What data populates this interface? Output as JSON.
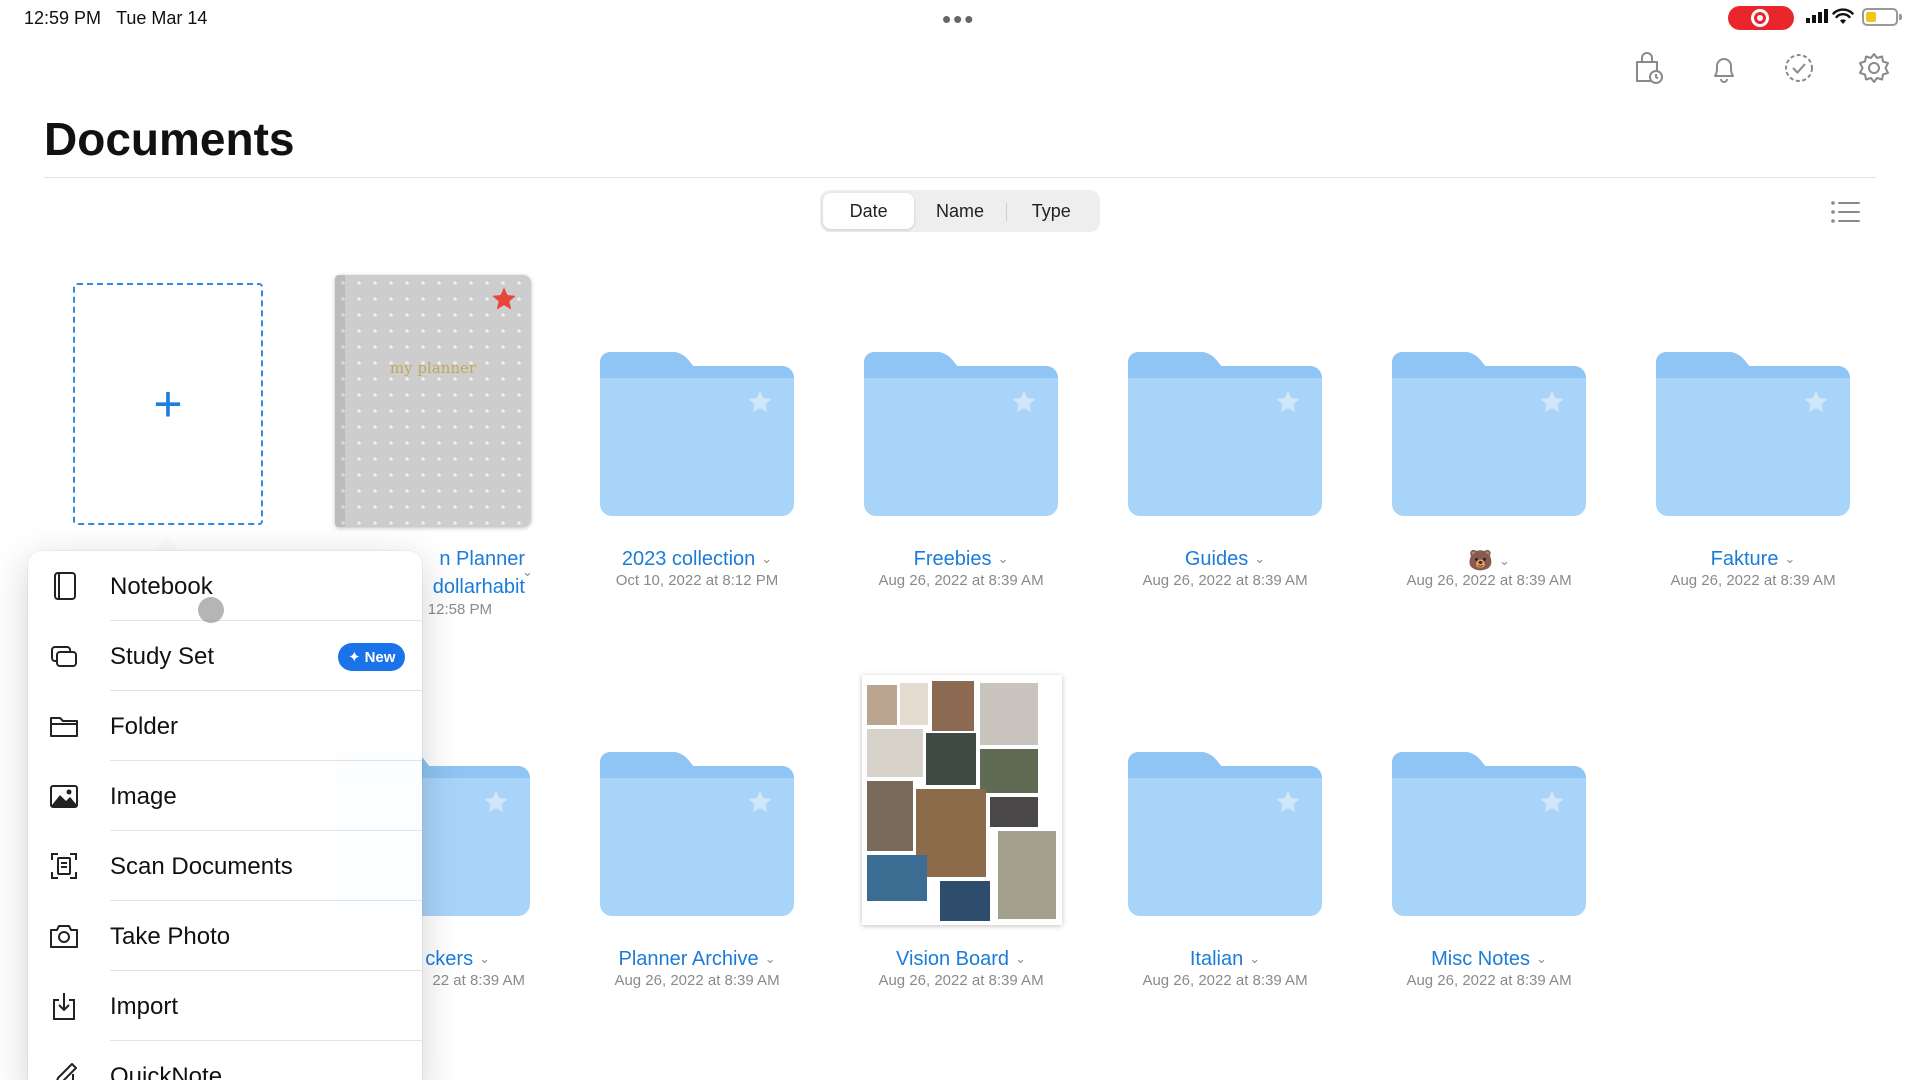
{
  "status": {
    "time": "12:59 PM",
    "date": "Tue Mar 14",
    "dots": "•••"
  },
  "page": {
    "title": "Documents"
  },
  "sort": {
    "options": [
      "Date",
      "Name",
      "Type"
    ],
    "active": "Date"
  },
  "notebook": {
    "cover_title": "my planner",
    "name_line1": "n Planner",
    "name_line2": "dollarhabit",
    "date": "12:58 PM"
  },
  "folders_row1": [
    {
      "name": "2023 collection",
      "date": "Oct 10, 2022 at 8:12 PM"
    },
    {
      "name": "Freebies",
      "date": "Aug 26, 2022 at 8:39 AM"
    },
    {
      "name": "Guides",
      "date": "Aug 26, 2022 at 8:39 AM"
    },
    {
      "name": "🐻",
      "date": "Aug 26, 2022 at 8:39 AM"
    },
    {
      "name": "Fakture",
      "date": "Aug 26, 2022 at 8:39 AM"
    }
  ],
  "folders_row2": [
    {
      "name": "ckers",
      "date": "22 at 8:39 AM"
    },
    {
      "name": "Planner Archive",
      "date": "Aug 26, 2022 at 8:39 AM"
    },
    {
      "name": "Vision Board",
      "date": "Aug 26, 2022 at 8:39 AM"
    },
    {
      "name": "Italian",
      "date": "Aug 26, 2022 at 8:39 AM"
    },
    {
      "name": "Misc Notes",
      "date": "Aug 26, 2022 at 8:39 AM"
    }
  ],
  "menu": {
    "items": [
      {
        "label": "Notebook"
      },
      {
        "label": "Study Set",
        "badge": "New"
      },
      {
        "label": "Folder"
      },
      {
        "label": "Image"
      },
      {
        "label": "Scan Documents"
      },
      {
        "label": "Take Photo"
      },
      {
        "label": "Import"
      },
      {
        "label": "QuickNote"
      }
    ]
  },
  "colors": {
    "accent": "#1b7cd8",
    "folder": "#a9d4fa",
    "record": "#e8262b",
    "favorite_star": "#e8453c"
  }
}
